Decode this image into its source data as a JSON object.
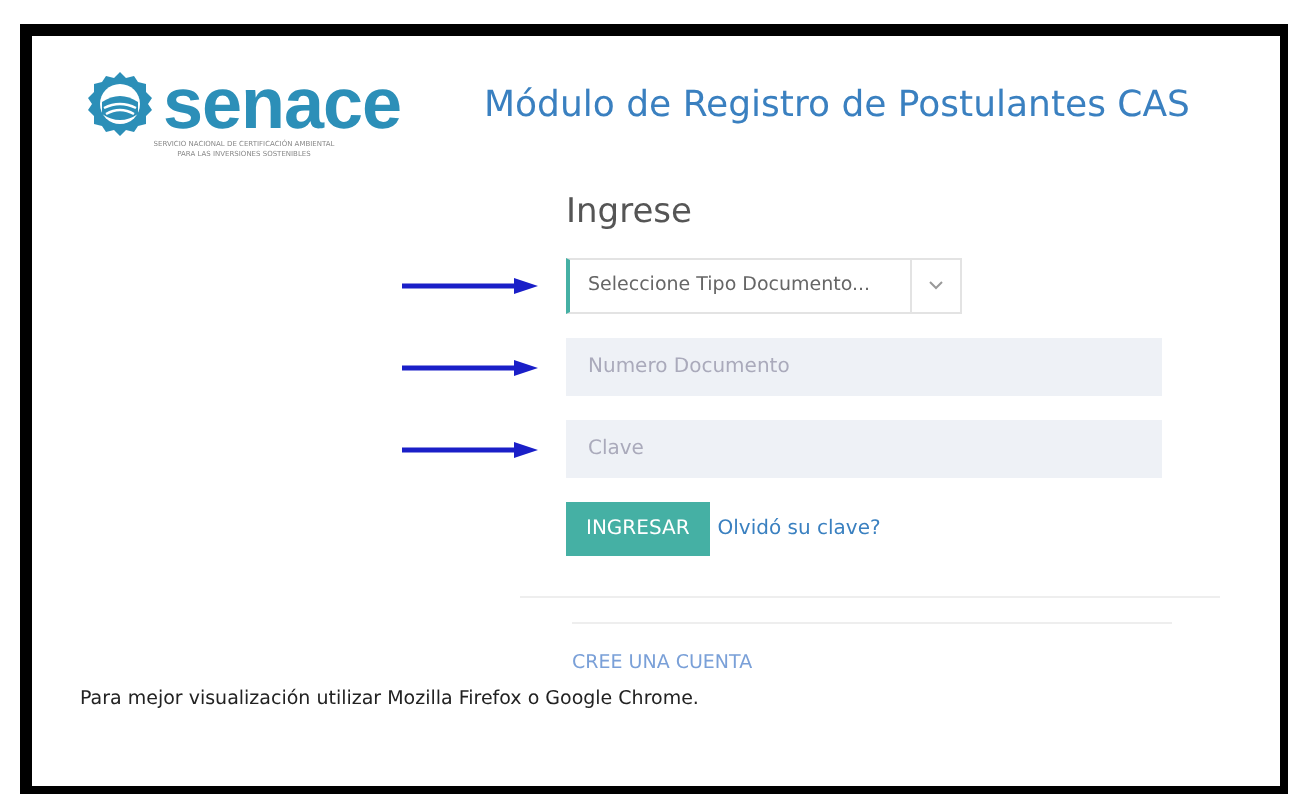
{
  "header": {
    "logo_text": "senace",
    "logo_subtitle": [
      "SERVICIO NACIONAL DE CERTIFICACIÓN AMBIENTAL",
      "PARA LAS INVERSIONES SOSTENIBLES"
    ],
    "title": "Módulo de Registro de Postulantes CAS"
  },
  "login": {
    "heading": "Ingrese",
    "fields": [
      {
        "kind": "select",
        "placeholder": "Seleccione Tipo Documento..."
      },
      {
        "kind": "text",
        "placeholder": "Numero Documento"
      },
      {
        "kind": "password",
        "placeholder": "Clave"
      }
    ],
    "submit": "INGRESAR",
    "forgot": "Olvidó su clave?",
    "create_account": "CREE UNA CUENTA"
  },
  "footer": "Para mejor visualización utilizar Mozilla Firefox o Google Chrome."
}
